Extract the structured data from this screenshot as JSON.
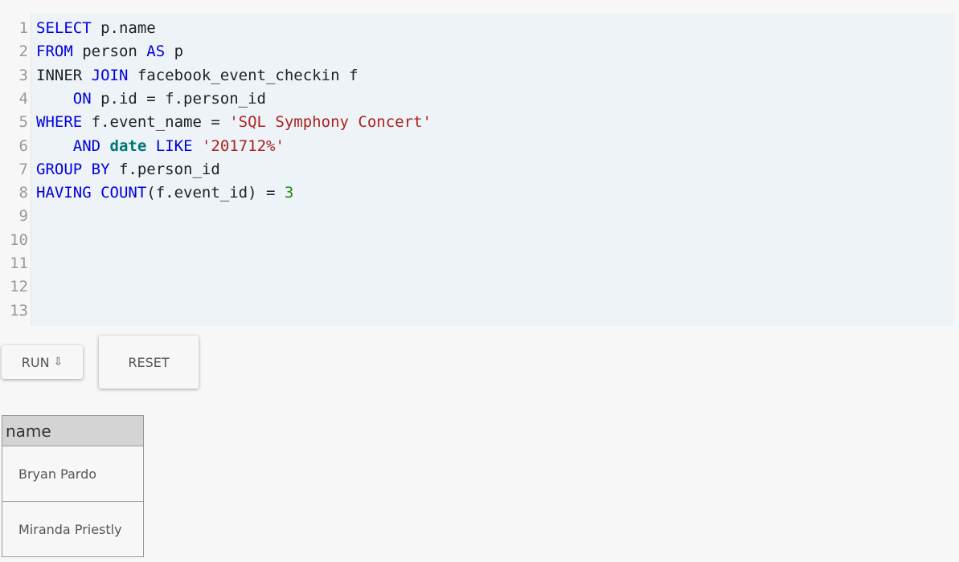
{
  "editor": {
    "line_numbers": [
      "1",
      "2",
      "3",
      "4",
      "5",
      "6",
      "7",
      "8",
      "9",
      "10",
      "11",
      "12",
      "13"
    ],
    "lines": [
      [
        {
          "t": "SELECT",
          "c": "kw"
        },
        {
          "t": " p.name",
          "c": ""
        }
      ],
      [
        {
          "t": "FROM",
          "c": "kw"
        },
        {
          "t": " person ",
          "c": ""
        },
        {
          "t": "AS",
          "c": "kw"
        },
        {
          "t": " p",
          "c": ""
        }
      ],
      [
        {
          "t": "INNER ",
          "c": ""
        },
        {
          "t": "JOIN",
          "c": "kw"
        },
        {
          "t": " facebook_event_checkin f",
          "c": ""
        }
      ],
      [
        {
          "t": "    ",
          "c": ""
        },
        {
          "t": "ON",
          "c": "kw"
        },
        {
          "t": " p.id = f.person_id",
          "c": ""
        }
      ],
      [
        {
          "t": "WHERE",
          "c": "kw"
        },
        {
          "t": " f.event_name = ",
          "c": ""
        },
        {
          "t": "'SQL Symphony Concert'",
          "c": "str"
        }
      ],
      [
        {
          "t": "    ",
          "c": ""
        },
        {
          "t": "AND",
          "c": "kw"
        },
        {
          "t": " ",
          "c": ""
        },
        {
          "t": "date",
          "c": "bi"
        },
        {
          "t": " ",
          "c": ""
        },
        {
          "t": "LIKE",
          "c": "kw"
        },
        {
          "t": " ",
          "c": ""
        },
        {
          "t": "'201712%'",
          "c": "str"
        }
      ],
      [
        {
          "t": "GROUP BY",
          "c": "kw"
        },
        {
          "t": " f.person_id",
          "c": ""
        }
      ],
      [
        {
          "t": "HAVING",
          "c": "kw"
        },
        {
          "t": " ",
          "c": ""
        },
        {
          "t": "COUNT",
          "c": "kw"
        },
        {
          "t": "(f.event_id) = ",
          "c": ""
        },
        {
          "t": "3",
          "c": "num"
        }
      ],
      [],
      [],
      [],
      [],
      []
    ]
  },
  "buttons": {
    "run_label": "RUN",
    "run_icon": "⇩",
    "reset_label": "RESET"
  },
  "results": {
    "columns": [
      "name"
    ],
    "rows": [
      [
        "Bryan Pardo"
      ],
      [
        "Miranda Priestly"
      ]
    ]
  }
}
